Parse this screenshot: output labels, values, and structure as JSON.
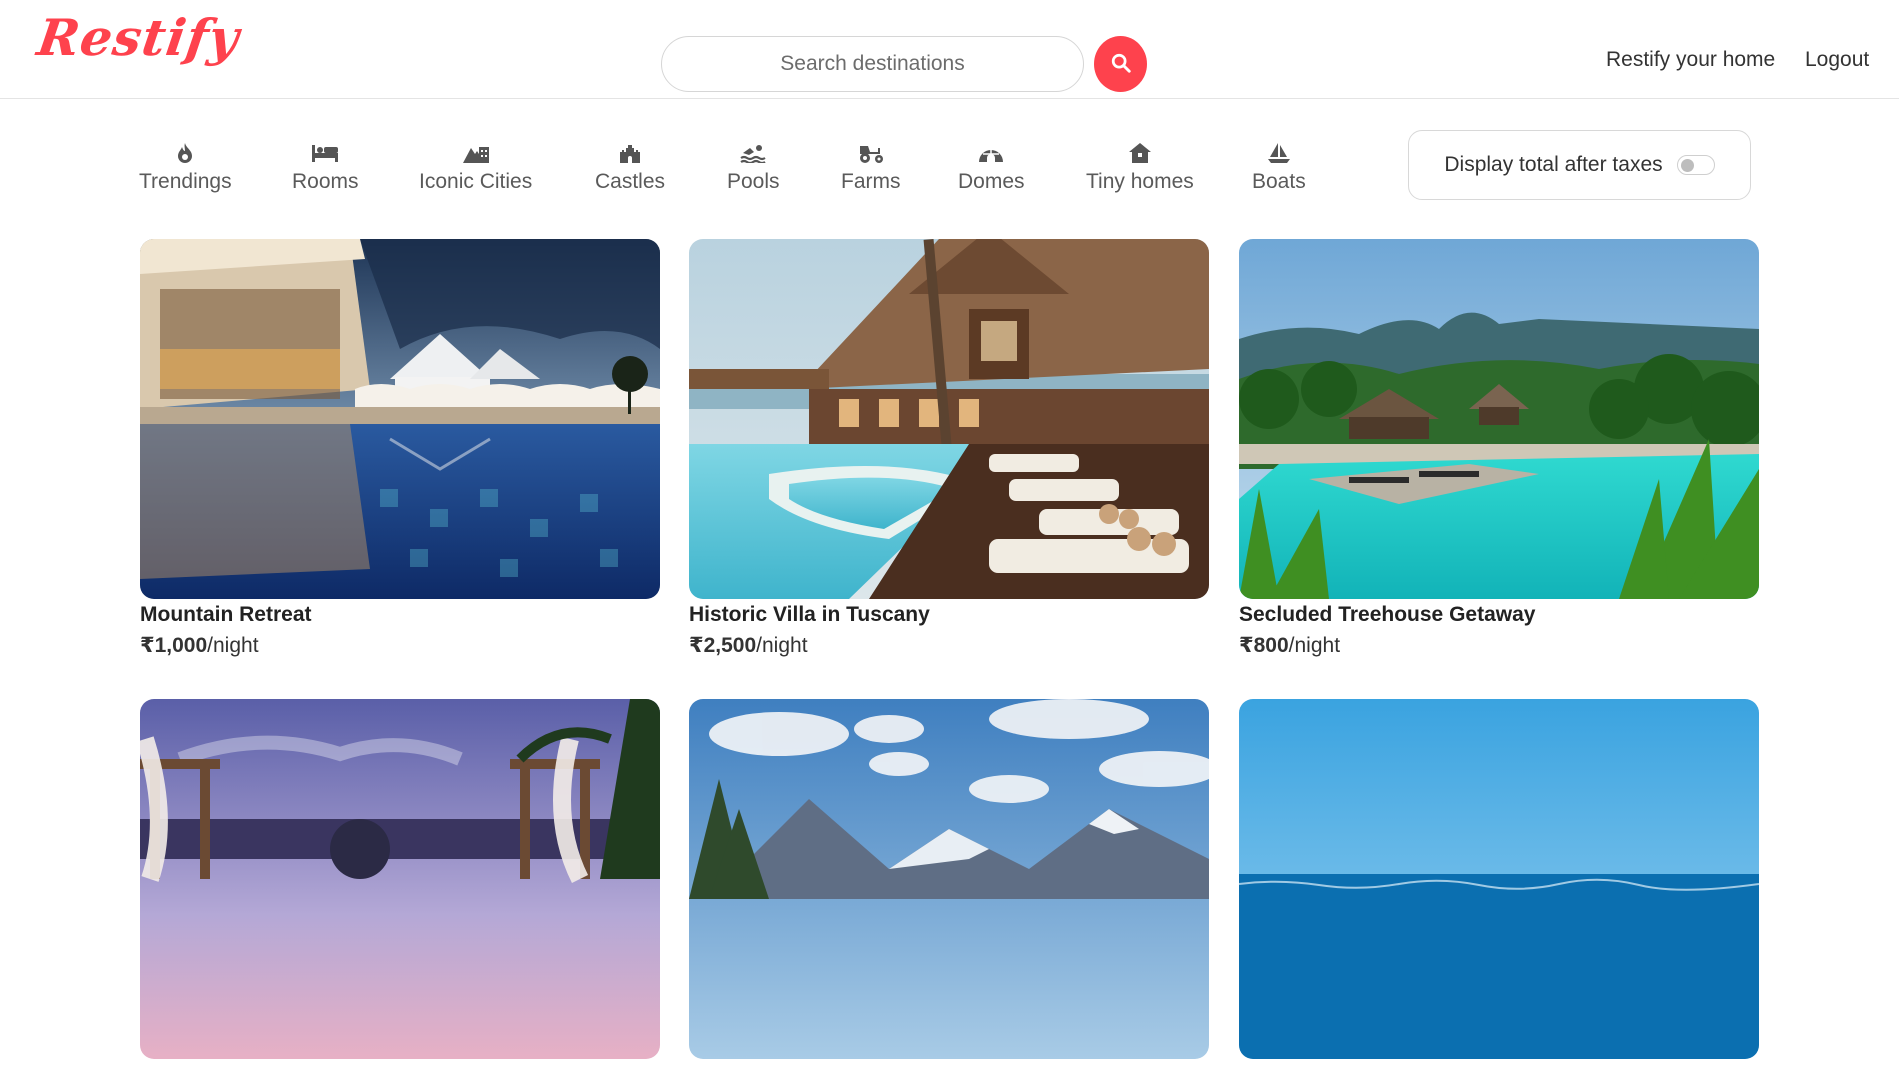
{
  "header": {
    "logo_text": "Restify",
    "search_placeholder": "Search destinations",
    "nav": {
      "restify_home": "Restify your home",
      "logout": "Logout"
    }
  },
  "filters": [
    {
      "label": "Trendings",
      "icon": "fire-icon"
    },
    {
      "label": "Rooms",
      "icon": "bed-icon"
    },
    {
      "label": "Iconic Cities",
      "icon": "mountain-city-icon"
    },
    {
      "label": "Castles",
      "icon": "castle-icon"
    },
    {
      "label": "Pools",
      "icon": "swimmer-icon"
    },
    {
      "label": "Farms",
      "icon": "tractor-icon"
    },
    {
      "label": "Domes",
      "icon": "igloo-icon"
    },
    {
      "label": "Tiny homes",
      "icon": "home-icon"
    },
    {
      "label": "Boats",
      "icon": "sailboat-icon"
    }
  ],
  "tax_toggle": {
    "label": "Display total after taxes",
    "enabled": false
  },
  "listings": [
    {
      "title": "Mountain Retreat",
      "price": "₹1,000",
      "unit": "/night"
    },
    {
      "title": "Historic Villa in Tuscany",
      "price": "₹2,500",
      "unit": "/night"
    },
    {
      "title": "Secluded Treehouse Getaway",
      "price": "₹800",
      "unit": "/night"
    },
    {
      "title": "",
      "price": "",
      "unit": ""
    },
    {
      "title": "",
      "price": "",
      "unit": ""
    },
    {
      "title": "",
      "price": "",
      "unit": ""
    }
  ],
  "colors": {
    "brand": "#fe424d"
  }
}
